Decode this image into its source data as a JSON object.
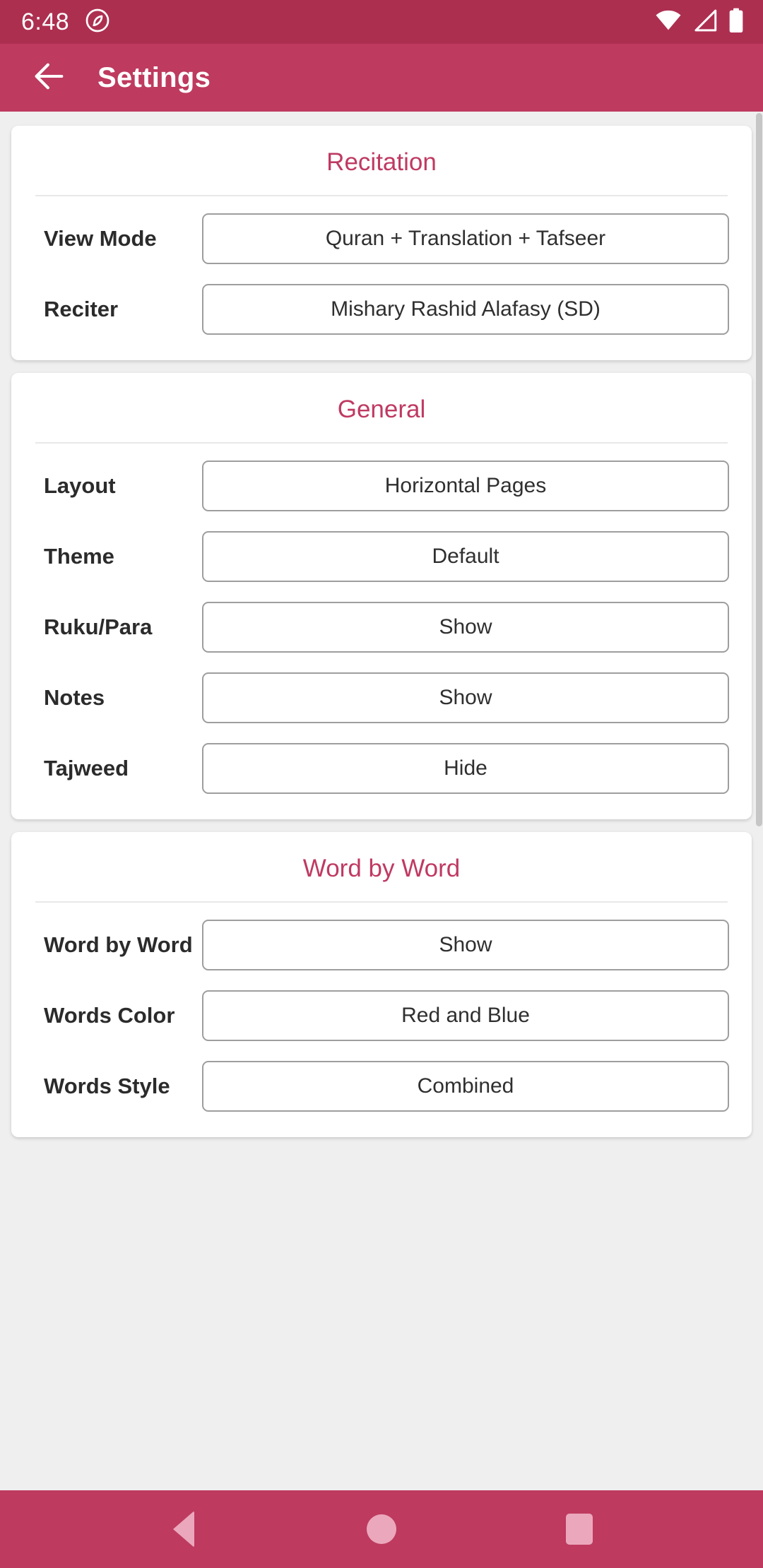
{
  "status_bar": {
    "clock": "6:48",
    "icons": [
      "notification-badge-icon",
      "wifi-icon",
      "cell-signal-icon",
      "battery-full-icon"
    ]
  },
  "app_bar": {
    "back_icon": "arrow-left-icon",
    "title": "Settings"
  },
  "colors": {
    "status_bar_bg": "#ad2f50",
    "app_bar_bg": "#be3a5f",
    "accent": "#bf3a62",
    "page_bg": "#efefef",
    "card_bg": "#ffffff",
    "nav_icon": "#eba8bc"
  },
  "cards": [
    {
      "title": "Recitation",
      "rows": [
        {
          "label": "View Mode",
          "value": "Quran + Translation + Tafseer"
        },
        {
          "label": "Reciter",
          "value": "Mishary Rashid Alafasy (SD)"
        }
      ]
    },
    {
      "title": "General",
      "rows": [
        {
          "label": "Layout",
          "value": "Horizontal Pages"
        },
        {
          "label": "Theme",
          "value": "Default"
        },
        {
          "label": "Ruku/Para",
          "value": "Show"
        },
        {
          "label": "Notes",
          "value": "Show"
        },
        {
          "label": "Tajweed",
          "value": "Hide"
        }
      ]
    },
    {
      "title": "Word by Word",
      "rows": [
        {
          "label": "Word by Word",
          "value": "Show"
        },
        {
          "label": "Words Color",
          "value": "Red and Blue"
        },
        {
          "label": "Words Style",
          "value": "Combined"
        }
      ]
    }
  ],
  "nav_bar": {
    "back_label": "back-nav",
    "home_label": "home-nav",
    "recents_label": "recents-nav"
  }
}
